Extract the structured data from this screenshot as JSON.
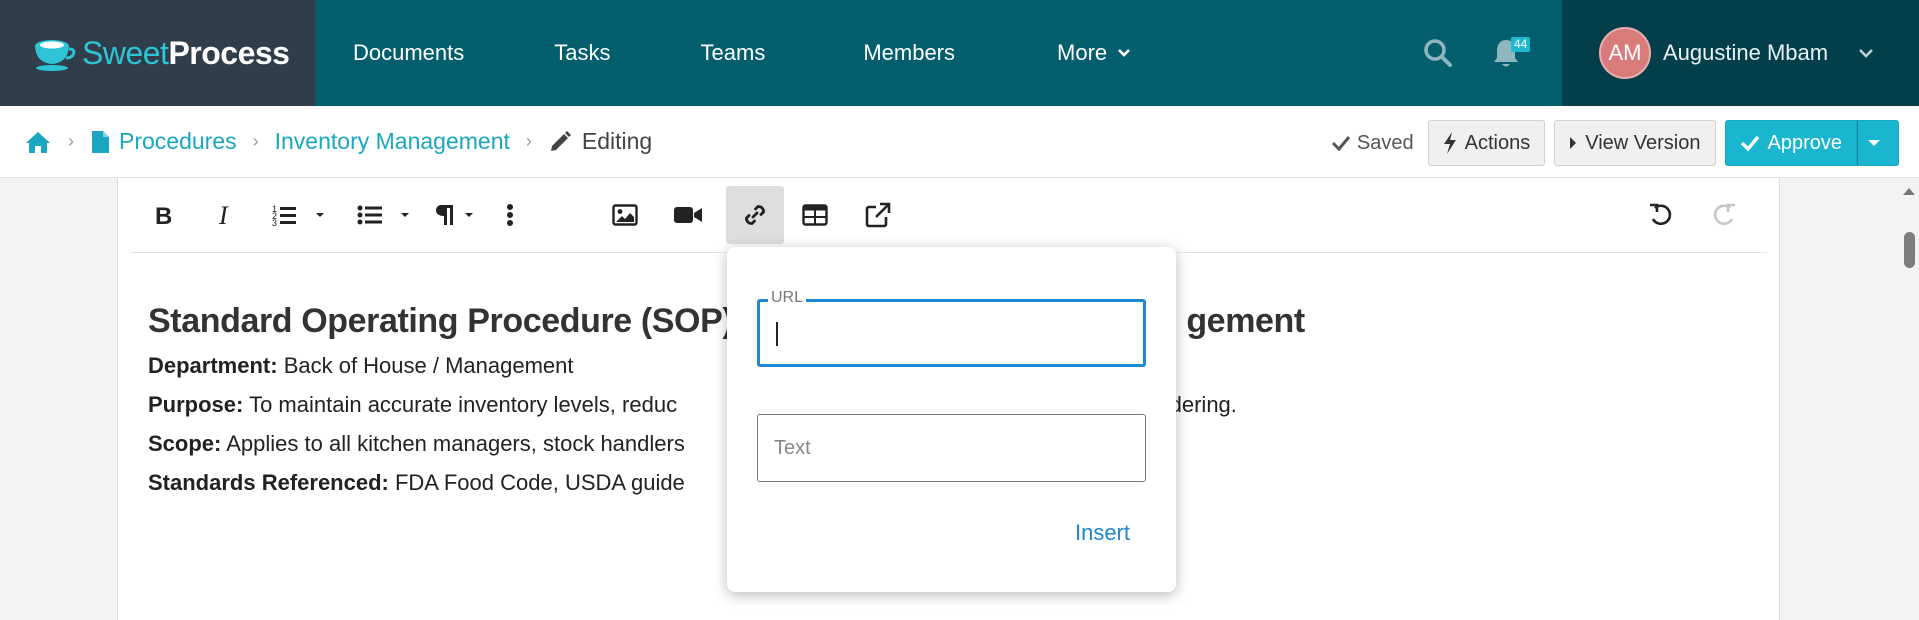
{
  "brand": {
    "name_part1": "Sweet",
    "name_part2": "Process"
  },
  "nav": {
    "links": [
      "Documents",
      "Tasks",
      "Teams",
      "Members",
      "More"
    ],
    "notifications_count": "44",
    "user": {
      "initials": "AM",
      "name": "Augustine Mbam"
    }
  },
  "breadcrumb": {
    "items": [
      "Procedures",
      "Inventory Management"
    ],
    "current": "Editing"
  },
  "actions": {
    "saved_label": "Saved",
    "actions_label": "Actions",
    "view_version_label": "View Version",
    "approve_label": "Approve"
  },
  "toolbar": {
    "buttons": [
      "bold",
      "italic",
      "ordered-list",
      "unordered-list",
      "paragraph-format",
      "more",
      "insert-image",
      "insert-video",
      "insert-link",
      "insert-table",
      "open-link",
      "undo",
      "redo"
    ],
    "active": "insert-link"
  },
  "document": {
    "title": "Standard Operating Procedure (SOP) - ",
    "title_tail": "gement",
    "lines": [
      {
        "label": "Department:",
        "text": " Back of House / Management"
      },
      {
        "label": "Purpose:",
        "text": " To maintain accurate inventory levels, reduc",
        "tail": "ordering."
      },
      {
        "label": "Scope:",
        "text": " Applies to all kitchen managers, stock handlers"
      },
      {
        "label": "Standards Referenced:",
        "text": " FDA Food Code, USDA guide"
      }
    ]
  },
  "link_popup": {
    "url_label": "URL",
    "url_value": "",
    "text_placeholder": "Text",
    "insert_label": "Insert"
  },
  "colors": {
    "nav_bg": "#045e6e",
    "brand_bg": "#2f3e4a",
    "user_bg": "#033f4b",
    "accent": "#1ab6d0",
    "link_blue": "#1d88d3"
  }
}
